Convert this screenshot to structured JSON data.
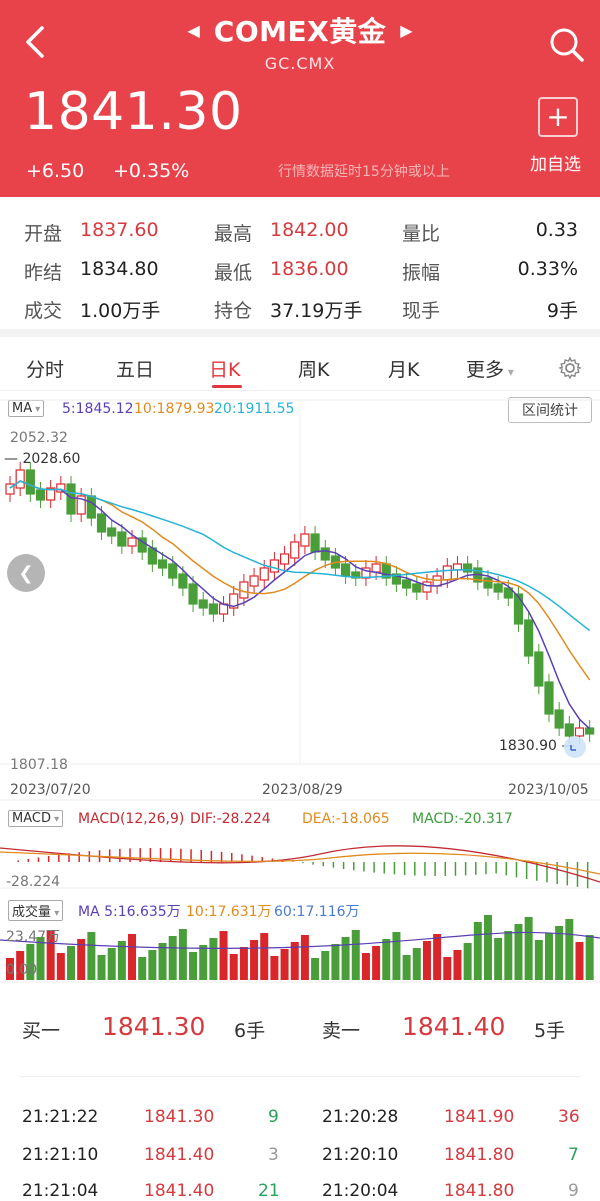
{
  "header": {
    "title": "COMEX黄金",
    "subtitle": "GC.CMX",
    "price": "1841.30",
    "change": "+6.50",
    "change_pct": "+0.35%",
    "delay_note": "行情数据延时15分钟或以上",
    "add_watch_label": "加自选",
    "bg_color": "#e8434a"
  },
  "stats": {
    "open_label": "开盘",
    "open": "1837.60",
    "high_label": "最高",
    "high": "1842.00",
    "volratio_label": "量比",
    "volratio": "0.33",
    "prev_label": "昨结",
    "prev": "1834.80",
    "low_label": "最低",
    "low": "1836.00",
    "amp_label": "振幅",
    "amp": "0.33%",
    "vol_label": "成交",
    "vol": "1.00万手",
    "oi_label": "持仓",
    "oi": "37.19万手",
    "cur_label": "现手",
    "cur": "9手"
  },
  "tabs": [
    "分时",
    "五日",
    "日K",
    "周K",
    "月K",
    "更多"
  ],
  "active_tab": "日K",
  "kline": {
    "ma_label": "MA",
    "ma5": "5:1845.12",
    "ma10": "10:1879.93",
    "ma20": "20:1911.55",
    "range_btn": "区间统计",
    "y_top": "2052.32",
    "y_bottom": "1807.18",
    "high_marker": "2028.60",
    "low_marker": "1830.90",
    "dates": [
      "2023/07/20",
      "2023/08/29",
      "2023/10/05"
    ]
  },
  "macd": {
    "label": "MACD",
    "params": "MACD(12,26,9)",
    "dif": "DIF:-28.224",
    "dea": "DEA:-18.065",
    "macd": "MACD:-20.317",
    "axis": "-28.224"
  },
  "volume": {
    "label": "成交量",
    "ma5": "MA 5:16.635万",
    "ma10": "10:17.631万",
    "ma60": "60:17.116万",
    "axis_top": "23.47万",
    "axis_bottom": "0.00"
  },
  "order_book": {
    "bid_label": "买一",
    "bid_price": "1841.30",
    "bid_qty": "6手",
    "ask_label": "卖一",
    "ask_price": "1841.40",
    "ask_qty": "5手"
  },
  "trades_left": [
    {
      "time": "21:21:22",
      "price": "1841.30",
      "qty": "9"
    },
    {
      "time": "21:21:10",
      "price": "1841.40",
      "qty": "3"
    },
    {
      "time": "21:21:04",
      "price": "1841.40",
      "qty": "21"
    }
  ],
  "trades_right": [
    {
      "time": "21:20:28",
      "price": "1841.90",
      "qty": "36"
    },
    {
      "time": "21:20:10",
      "price": "1841.80",
      "qty": "7"
    },
    {
      "time": "21:20:04",
      "price": "1841.80",
      "qty": "9"
    }
  ]
}
